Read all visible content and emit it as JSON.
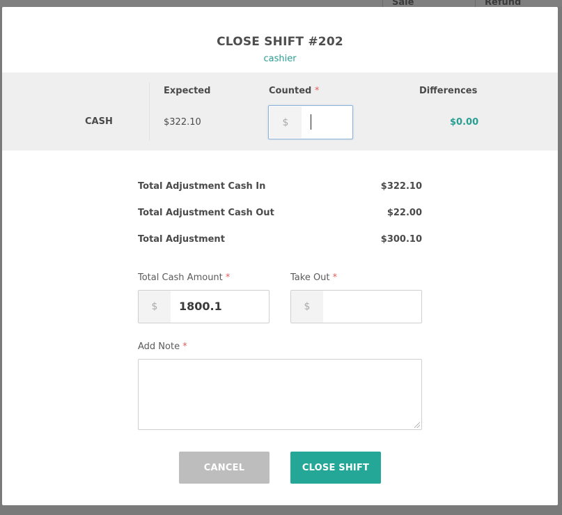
{
  "background": {
    "headers": [
      "Sale",
      "Refund"
    ]
  },
  "modal": {
    "title": "CLOSE SHIFT #202",
    "subtitle": "cashier"
  },
  "cash_table": {
    "row_label": "CASH",
    "columns": {
      "expected": "Expected",
      "counted": "Counted",
      "differences": "Differences"
    },
    "required_marker": "*",
    "expected_value": "$322.10",
    "counted_prefix": "$",
    "counted_value": "",
    "difference_value": "$0.00"
  },
  "summary": {
    "rows": [
      {
        "label": "Total Adjustment Cash In",
        "value": "$322.10"
      },
      {
        "label": "Total Adjustment Cash Out",
        "value": "$22.00"
      },
      {
        "label": "Total Adjustment",
        "value": "$300.10"
      }
    ]
  },
  "form": {
    "total_cash_label": "Total Cash Amount",
    "total_cash_prefix": "$",
    "total_cash_value": "1800.1",
    "take_out_label": "Take Out",
    "take_out_prefix": "$",
    "take_out_value": "",
    "note_label": "Add Note",
    "note_value": "",
    "required_marker": "*"
  },
  "buttons": {
    "cancel": "CANCEL",
    "close_shift": "CLOSE SHIFT"
  },
  "colors": {
    "accent": "#24a797",
    "teal_text": "#2a9d93",
    "required": "#e55d5d",
    "cancel_bg": "#bdbdbd"
  }
}
